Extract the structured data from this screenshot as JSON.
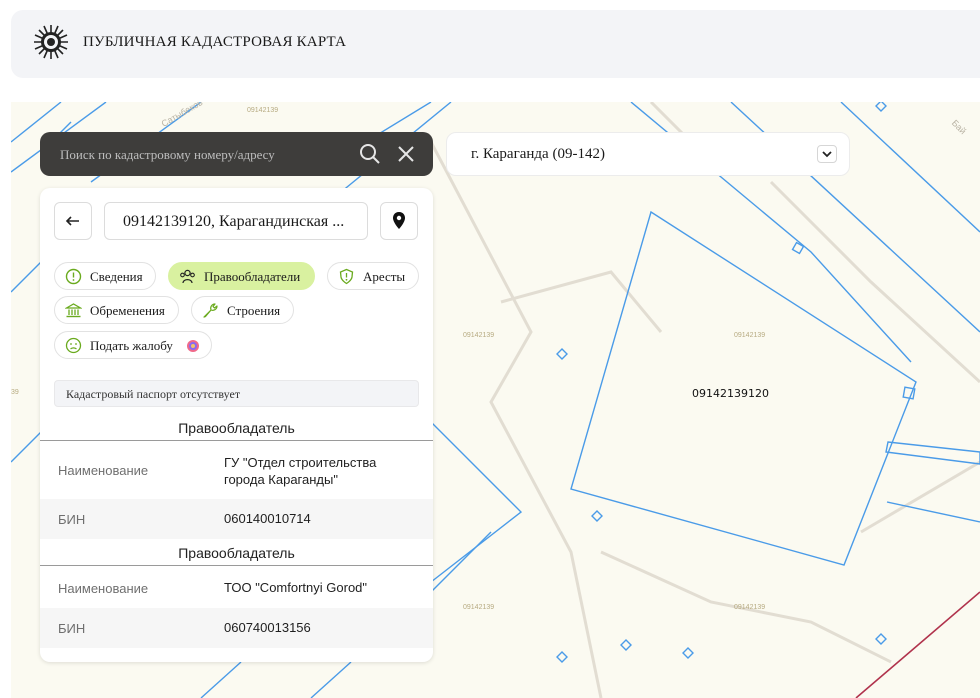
{
  "header": {
    "title": "ПУБЛИЧНАЯ КАДАСТРОВАЯ КАРТА",
    "logo_icon": "emblem-icon"
  },
  "search": {
    "placeholder": "Поиск по кадастровому номеру/адресу",
    "value": ""
  },
  "region": {
    "selected": "г. Караганда (09-142)"
  },
  "parcel": {
    "title": "09142139120, Карагандинская ..."
  },
  "tabs": [
    {
      "label": "Сведения",
      "icon": "info-circle-icon",
      "active": false
    },
    {
      "label": "Правообладатели",
      "icon": "users-icon",
      "active": true
    },
    {
      "label": "Аресты",
      "icon": "shield-alert-icon",
      "active": false
    },
    {
      "label": "Обременения",
      "icon": "bank-icon",
      "active": false
    },
    {
      "label": "Строения",
      "icon": "wrench-icon",
      "active": false
    },
    {
      "label": "Подать жалобу",
      "icon": "sad-face-icon",
      "active": false
    }
  ],
  "passport_note": "Кадастровый паспорт отсутствует",
  "owners": [
    {
      "section_title": "Правообладатель",
      "name_key": "Наименование",
      "name_value": "ГУ \"Отдел строительства города Караганды\"",
      "bin_key": "БИН",
      "bin_value": "060140010714"
    },
    {
      "section_title": "Правообладатель",
      "name_key": "Наименование",
      "name_value": "ТОО \"Comfortnyi Gorod\"",
      "bin_key": "БИН",
      "bin_value": "060740013156"
    }
  ],
  "map": {
    "parcel_label": "09142139120",
    "block_labels": [
      "09142139",
      "09142139",
      "09142139",
      "09142139",
      "09142139",
      "39"
    ],
    "street_labels": [
      "Бай",
      "Сатыбеков"
    ],
    "colors": {
      "parcel_line": "#4a9be8",
      "background": "#fbfaf1",
      "road": "#e2ddd2",
      "boundary": "#b0324c"
    }
  }
}
